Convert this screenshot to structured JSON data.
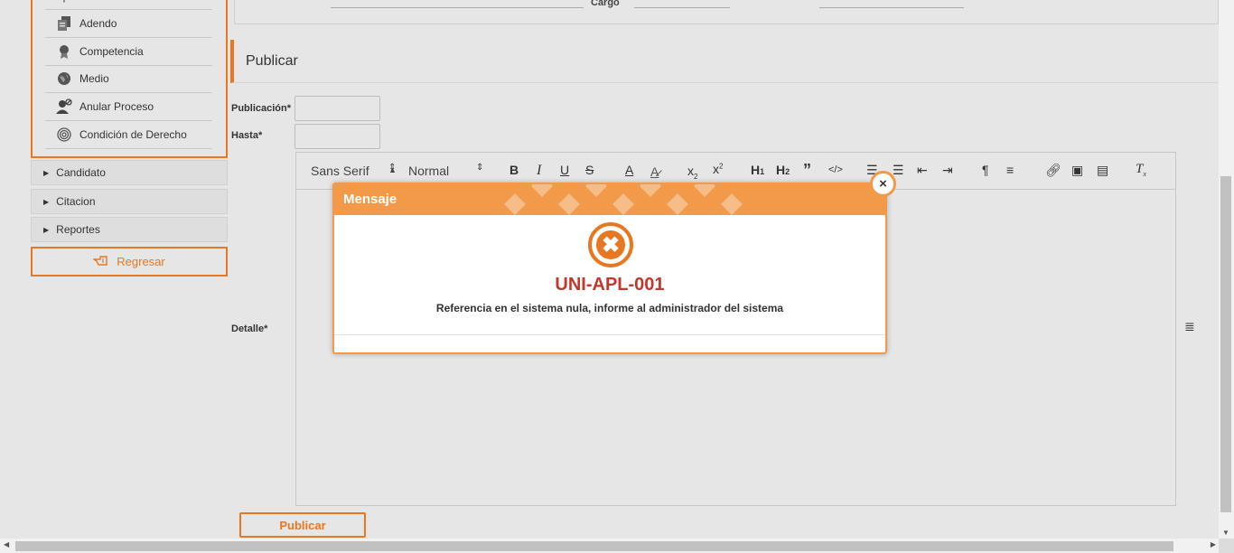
{
  "sidebar": {
    "sub_items": [
      {
        "label": "Adendo",
        "icon": "document-stack-icon"
      },
      {
        "label": "Competencia",
        "icon": "ribbon-award-icon"
      },
      {
        "label": "Medio",
        "icon": "globe-icon"
      },
      {
        "label": "Anular Proceso",
        "icon": "user-cancel-icon"
      },
      {
        "label": "Condición de Derecho",
        "icon": "fingerprint-icon"
      }
    ],
    "accordions": [
      {
        "label": "Candidato"
      },
      {
        "label": "Citacion"
      },
      {
        "label": "Reportes"
      }
    ],
    "regresar_label": "Regresar"
  },
  "top": {
    "cargo_label": "Cargo"
  },
  "publicar": {
    "title": "Publicar",
    "publicacion_label": "Publicación*",
    "publicacion_value": "",
    "hasta_label": "Hasta*",
    "hasta_value": "",
    "detalle_label": "Detalle*",
    "editor": {
      "font_select": "Sans Serif",
      "size_select": "Normal",
      "buttons": [
        "bold",
        "italic",
        "underline",
        "strike",
        "color",
        "background",
        "subscript",
        "superscript",
        "header-1",
        "header-2",
        "blockquote",
        "code-block",
        "ordered-list",
        "bullet-list",
        "indent-decrease",
        "indent-increase",
        "direction-rtl",
        "align",
        "link",
        "image",
        "video",
        "clean"
      ]
    },
    "button_label": "Publicar"
  },
  "modal": {
    "title": "Mensaje",
    "code": "UNI-APL-001",
    "message": "Referencia en el sistema nula, informe al administrador del sistema",
    "close_symbol": "×",
    "error_symbol": "✖"
  },
  "colors": {
    "accent": "#e87722",
    "modal_header": "#f29a4a",
    "error_code": "#c0392b",
    "background": "#e6e6e6"
  }
}
